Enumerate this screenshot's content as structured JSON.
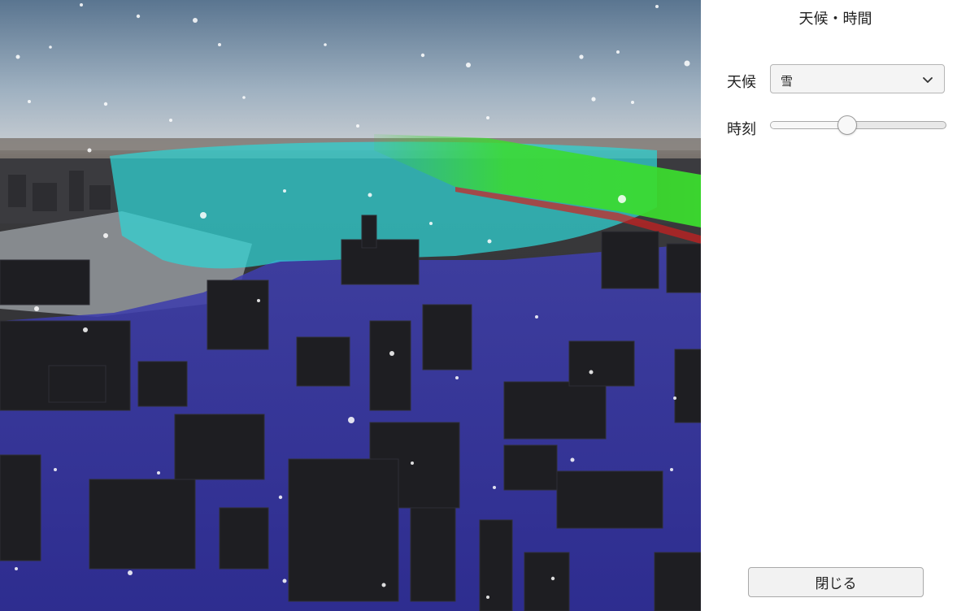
{
  "panel": {
    "title": "天候・時間",
    "weather_label": "天候",
    "weather_value": "雪",
    "time_label": "時刻",
    "time_slider_fraction": 0.43,
    "close_label": "閉じる"
  },
  "icons": {
    "dropdown": "chevron-down-icon"
  },
  "colors": {
    "flood_water": "#3b3aa8",
    "hazard_zone": "#2fd6d6",
    "green_band": "#3bdc2e",
    "panel_bg": "#ffffff"
  }
}
